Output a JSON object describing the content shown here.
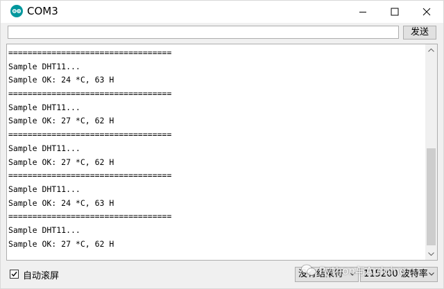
{
  "window": {
    "title": "COM3",
    "accent": "#00979d"
  },
  "send": {
    "input_value": "",
    "button_label": "发送"
  },
  "output": {
    "lines": [
      "==================================",
      "Sample DHT11...",
      "Sample OK: 24 *C, 63 H",
      "==================================",
      "Sample DHT11...",
      "Sample OK: 27 *C, 62 H",
      "==================================",
      "Sample DHT11...",
      "Sample OK: 27 *C, 62 H",
      "==================================",
      "Sample DHT11...",
      "Sample OK: 24 *C, 63 H",
      "==================================",
      "Sample DHT11...",
      "Sample OK: 27 *C, 62 H"
    ]
  },
  "bottom": {
    "autoscroll_label": "自动滚屏",
    "autoscroll_checked": true,
    "line_ending": "没有结束符",
    "baud_rate": "115200 波特率"
  },
  "watermark": {
    "text": "Python与Arduino"
  }
}
